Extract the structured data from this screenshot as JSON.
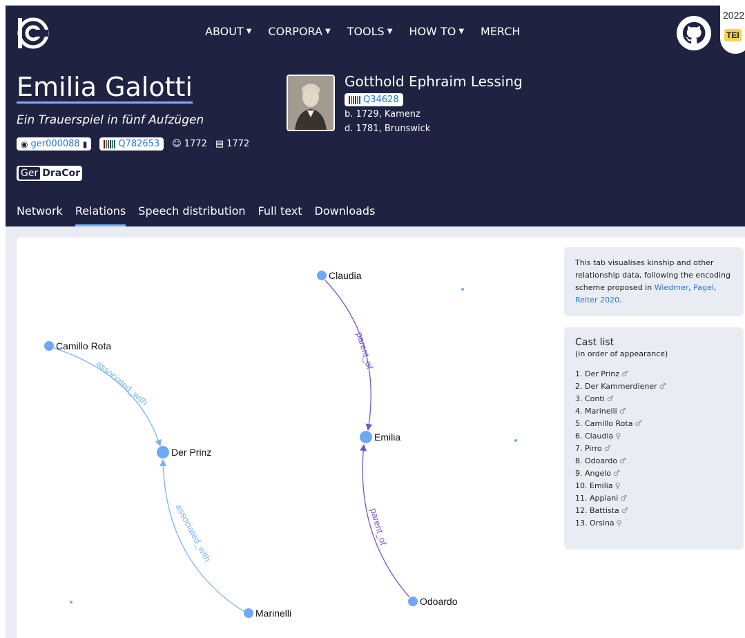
{
  "nav": {
    "items": [
      {
        "label": "ABOUT",
        "dropdown": true
      },
      {
        "label": "CORPORA",
        "dropdown": true
      },
      {
        "label": "TOOLS",
        "dropdown": true
      },
      {
        "label": "HOW TO",
        "dropdown": true
      },
      {
        "label": "MERCH",
        "dropdown": false
      }
    ]
  },
  "tei_badge": {
    "year": "2022",
    "label": "TEI"
  },
  "play": {
    "title": "Emilia Galotti",
    "subtitle": "Ein Trauerspiel in fünf Aufzügen",
    "id": "ger000088",
    "wikidata": "Q782653",
    "written_year": "1772",
    "printed_year": "1772",
    "corpus_prefix": "Ger",
    "corpus_name": "DraCor"
  },
  "author": {
    "name": "Gotthold Ephraim Lessing",
    "wikidata": "Q34628",
    "born": "b. 1729, Kamenz",
    "died": "d. 1781, Brunswick"
  },
  "tabs": [
    {
      "label": "Network",
      "active": false
    },
    {
      "label": "Relations",
      "active": true
    },
    {
      "label": "Speech distribution",
      "active": false
    },
    {
      "label": "Full text",
      "active": false
    },
    {
      "label": "Downloads",
      "active": false
    }
  ],
  "info": {
    "text_before": "This tab visualises kinship and other relationship data, following the encoding scheme proposed in ",
    "link1": "Wiedmer",
    "sep1": ", ",
    "link2": "Pagel",
    "sep2": ", ",
    "link3": "Reiter 2020",
    "text_after": "."
  },
  "cast": {
    "title": "Cast list",
    "subtitle": "(in order of appearance)",
    "items": [
      {
        "label": "1. Der Prinz",
        "gender": "♂"
      },
      {
        "label": "2. Der Kammerdiener",
        "gender": "♂"
      },
      {
        "label": "3. Conti",
        "gender": "♂"
      },
      {
        "label": "4. Marinelli",
        "gender": "♂"
      },
      {
        "label": "5. Camillo Rota",
        "gender": "♂"
      },
      {
        "label": "6. Claudia",
        "gender": "♀"
      },
      {
        "label": "7. Pirro",
        "gender": "♂"
      },
      {
        "label": "8. Odoardo",
        "gender": "♂"
      },
      {
        "label": "9. Angelo",
        "gender": "♂"
      },
      {
        "label": "10. Emilia",
        "gender": "♀"
      },
      {
        "label": "11. Appiani",
        "gender": "♂"
      },
      {
        "label": "12. Battista",
        "gender": "♂"
      },
      {
        "label": "13. Orsina",
        "gender": "♀"
      }
    ]
  },
  "graph": {
    "node_color": "#6fa8f5",
    "associated_color": "#7cb4ee",
    "parent_color": "#7a55c7",
    "nodes": [
      {
        "id": "claudia",
        "label": "Claudia"
      },
      {
        "id": "camillo",
        "label": "Camillo Rota"
      },
      {
        "id": "prinz",
        "label": "Der Prinz"
      },
      {
        "id": "emilia",
        "label": "Emilia"
      },
      {
        "id": "marinelli",
        "label": "Marinelli"
      },
      {
        "id": "odoardo",
        "label": "Odoardo"
      }
    ],
    "edges": [
      {
        "from": "camillo",
        "to": "prinz",
        "label": "associated_with",
        "type": "associated"
      },
      {
        "from": "marinelli",
        "to": "prinz",
        "label": "associated_with",
        "type": "associated"
      },
      {
        "from": "claudia",
        "to": "emilia",
        "label": "parent_of",
        "type": "parent"
      },
      {
        "from": "odoardo",
        "to": "emilia",
        "label": "parent_of",
        "type": "parent"
      }
    ]
  }
}
